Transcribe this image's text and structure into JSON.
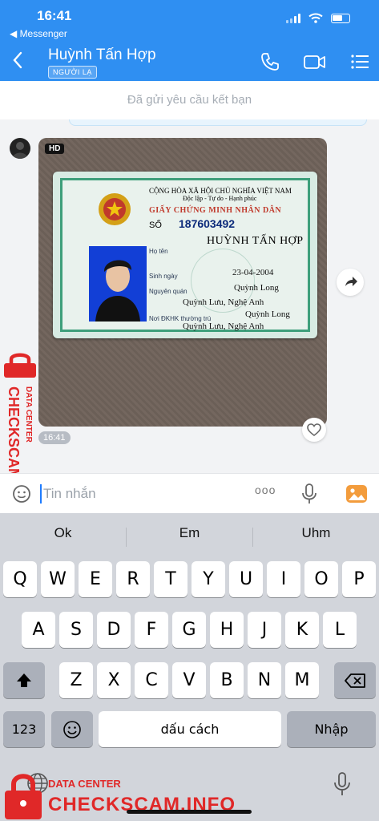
{
  "status": {
    "time": "16:41",
    "back_app": "◀ Messenger"
  },
  "header": {
    "contact_name": "Huỳnh Tấn Hợp",
    "badge": "NGƯỜI LẠ"
  },
  "friend_request": "Đã gửi yêu cầu kết bạn",
  "message": {
    "hd_badge": "HD",
    "time": "16:41",
    "id_card": {
      "line1": "CỘNG HÒA XÃ HỘI CHỦ NGHĨA VIỆT NAM",
      "line2": "Độc lập - Tự do - Hạnh phúc",
      "title": "GIẤY CHỨNG MINH NHÂN DÂN",
      "so_label": "SỐ",
      "number": "187603492",
      "name_label": "Họ tên",
      "name": "HUỲNH TẤN HỢP",
      "dob_label": "Sinh ngày",
      "dob": "23-04-2004",
      "origin_label": "Nguyên quán",
      "origin_1": "Quỳnh Long",
      "origin_2": "Quỳnh Lưu, Nghệ Anh",
      "residence_label": "Nơi ĐKHK thường trú",
      "residence_1": "Quỳnh Long",
      "residence_2": "Quỳnh Lưu, Nghệ Anh"
    }
  },
  "composer": {
    "placeholder": "Tin nhắn",
    "more": "ooo"
  },
  "keyboard": {
    "suggestions": [
      "Ok",
      "Em",
      "Uhm"
    ],
    "row1": [
      "Q",
      "W",
      "E",
      "R",
      "T",
      "Y",
      "U",
      "I",
      "O",
      "P"
    ],
    "row2": [
      "A",
      "S",
      "D",
      "F",
      "G",
      "H",
      "J",
      "K",
      "L"
    ],
    "row3": [
      "Z",
      "X",
      "C",
      "V",
      "B",
      "N",
      "M"
    ],
    "numbers": "123",
    "space": "dấu cách",
    "return": "Nhập"
  },
  "watermark": {
    "top": "DATA CENTER",
    "main": "CHECKSCAM.INFO"
  },
  "colors": {
    "header": "#2f8ff2",
    "accent": "#1f7cff",
    "watermark": "#e02828",
    "card_green": "#3e9f7b"
  }
}
